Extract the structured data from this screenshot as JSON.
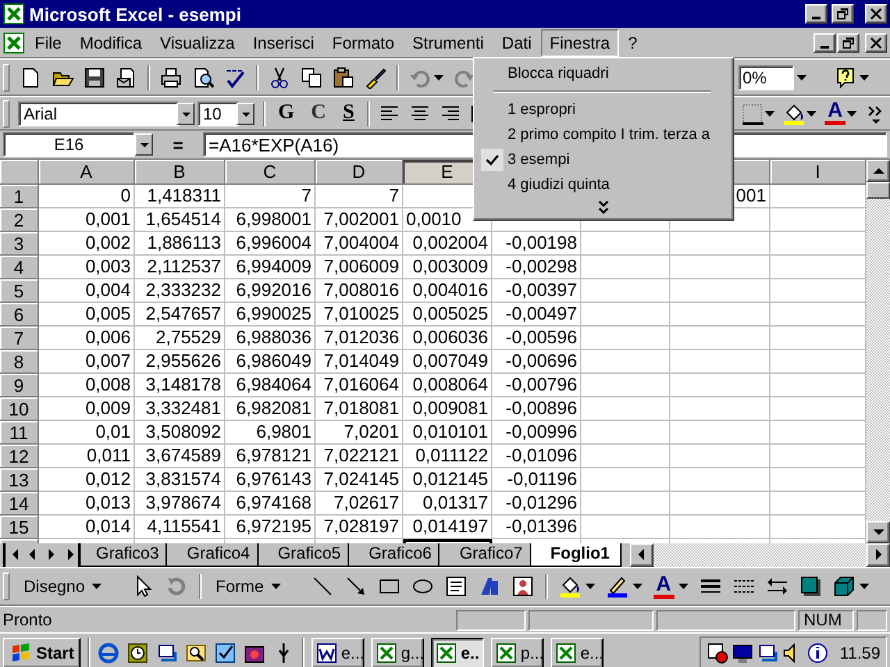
{
  "window": {
    "title": "Microsoft Excel - esempi"
  },
  "menu_bar": [
    {
      "label": "File",
      "selected": false
    },
    {
      "label": "Modifica",
      "selected": false
    },
    {
      "label": "Visualizza",
      "selected": false
    },
    {
      "label": "Inserisci",
      "selected": false
    },
    {
      "label": "Formato",
      "selected": false
    },
    {
      "label": "Strumenti",
      "selected": false
    },
    {
      "label": "Dati",
      "selected": false
    },
    {
      "label": "Finestra",
      "selected": true
    },
    {
      "label": "?",
      "selected": false
    }
  ],
  "window_menu": {
    "items": [
      {
        "kind": "command",
        "label": "Blocca riquadri",
        "checked": false
      },
      {
        "kind": "separator"
      },
      {
        "kind": "command",
        "label": "1 espropri",
        "checked": false
      },
      {
        "kind": "command",
        "label": "2 primo compito I trim. terza a",
        "checked": false
      },
      {
        "kind": "command",
        "label": "3 esempi",
        "checked": true
      },
      {
        "kind": "command",
        "label": "4 giudizi quinta",
        "checked": false
      },
      {
        "kind": "more"
      }
    ]
  },
  "standard_toolbar": {
    "undo": {
      "disabled": true
    },
    "redo": {
      "disabled": true
    },
    "zoom": "0%"
  },
  "formatting_toolbar": {
    "font": "Arial",
    "size": "10",
    "style_buttons": [
      "G",
      "C",
      "S"
    ],
    "font_color_label": "A"
  },
  "formula_bar": {
    "name_box": "E16",
    "equals": "=",
    "formula": "=A16*EXP(A16)"
  },
  "sheet": {
    "columns": [
      {
        "label": "A",
        "selected": false
      },
      {
        "label": "B",
        "selected": false
      },
      {
        "label": "C",
        "selected": false
      },
      {
        "label": "D",
        "selected": false
      },
      {
        "label": "E",
        "selected": true
      },
      null,
      null,
      null,
      {
        "label": "I",
        "selected": false
      }
    ],
    "rows": [
      {
        "header": "1",
        "cells": [
          "0",
          "1,418311",
          "7",
          "7",
          null,
          null,
          null,
          "001",
          null
        ]
      },
      {
        "header": "2",
        "cells": [
          "0,001",
          "1,654514",
          "6,998001",
          "7,002001",
          "0,0010",
          null,
          null,
          null,
          null
        ]
      },
      {
        "header": "3",
        "cells": [
          "0,002",
          "1,886113",
          "6,996004",
          "7,004004",
          "0,002004",
          "-0,00198",
          null,
          null,
          null
        ]
      },
      {
        "header": "4",
        "cells": [
          "0,003",
          "2,112537",
          "6,994009",
          "7,006009",
          "0,003009",
          "-0,00298",
          null,
          null,
          null
        ]
      },
      {
        "header": "5",
        "cells": [
          "0,004",
          "2,333232",
          "6,992016",
          "7,008016",
          "0,004016",
          "-0,00397",
          null,
          null,
          null
        ]
      },
      {
        "header": "6",
        "cells": [
          "0,005",
          "2,547657",
          "6,990025",
          "7,010025",
          "0,005025",
          "-0,00497",
          null,
          null,
          null
        ]
      },
      {
        "header": "7",
        "cells": [
          "0,006",
          "2,75529",
          "6,988036",
          "7,012036",
          "0,006036",
          "-0,00596",
          null,
          null,
          null
        ]
      },
      {
        "header": "8",
        "cells": [
          "0,007",
          "2,955626",
          "6,986049",
          "7,014049",
          "0,007049",
          "-0,00696",
          null,
          null,
          null
        ]
      },
      {
        "header": "9",
        "cells": [
          "0,008",
          "3,148178",
          "6,984064",
          "7,016064",
          "0,008064",
          "-0,00796",
          null,
          null,
          null
        ]
      },
      {
        "header": "10",
        "cells": [
          "0,009",
          "3,332481",
          "6,982081",
          "7,018081",
          "0,009081",
          "-0,00896",
          null,
          null,
          null
        ]
      },
      {
        "header": "11",
        "cells": [
          "0,01",
          "3,508092",
          "6,9801",
          "7,0201",
          "0,010101",
          "-0,00996",
          null,
          null,
          null
        ]
      },
      {
        "header": "12",
        "cells": [
          "0,011",
          "3,674589",
          "6,978121",
          "7,022121",
          "0,011122",
          "-0,01096",
          null,
          null,
          null
        ]
      },
      {
        "header": "13",
        "cells": [
          "0,012",
          "3,831574",
          "6,976143",
          "7,024145",
          "0,012145",
          "-0,01196",
          null,
          null,
          null
        ]
      },
      {
        "header": "14",
        "cells": [
          "0,013",
          "3,978674",
          "6,974168",
          "7,02617",
          "0,01317",
          "-0,01296",
          null,
          null,
          null
        ]
      },
      {
        "header": "15",
        "cells": [
          "0,014",
          "4,115541",
          "6,972195",
          "7,028197",
          "0,014197",
          "-0,01396",
          null,
          null,
          null
        ]
      }
    ]
  },
  "sheet_tabs": [
    {
      "label": "Grafico3",
      "selected": false
    },
    {
      "label": "Grafico4",
      "selected": false
    },
    {
      "label": "Grafico5",
      "selected": false
    },
    {
      "label": "Grafico6",
      "selected": false
    },
    {
      "label": "Grafico7",
      "selected": false
    },
    {
      "label": "Foglio1",
      "selected": true
    }
  ],
  "drawing_toolbar": {
    "draw_menu": "Disegno",
    "shapes_menu": "Forme",
    "font_color_label": "A"
  },
  "status_bar": {
    "message": "Pronto",
    "indicators": [
      "NUM"
    ]
  },
  "taskbar": {
    "start": "Start",
    "tasks": [
      {
        "label": "e...",
        "kind": "document",
        "selected": false
      },
      {
        "label": "g...",
        "kind": "spreadsheet",
        "selected": false
      },
      {
        "label": "e..",
        "kind": "spreadsheet",
        "selected": true
      },
      {
        "label": "p...",
        "kind": "spreadsheet",
        "selected": false
      },
      {
        "label": "e...",
        "kind": "spreadsheet",
        "selected": false
      }
    ],
    "clock": "11.59"
  }
}
